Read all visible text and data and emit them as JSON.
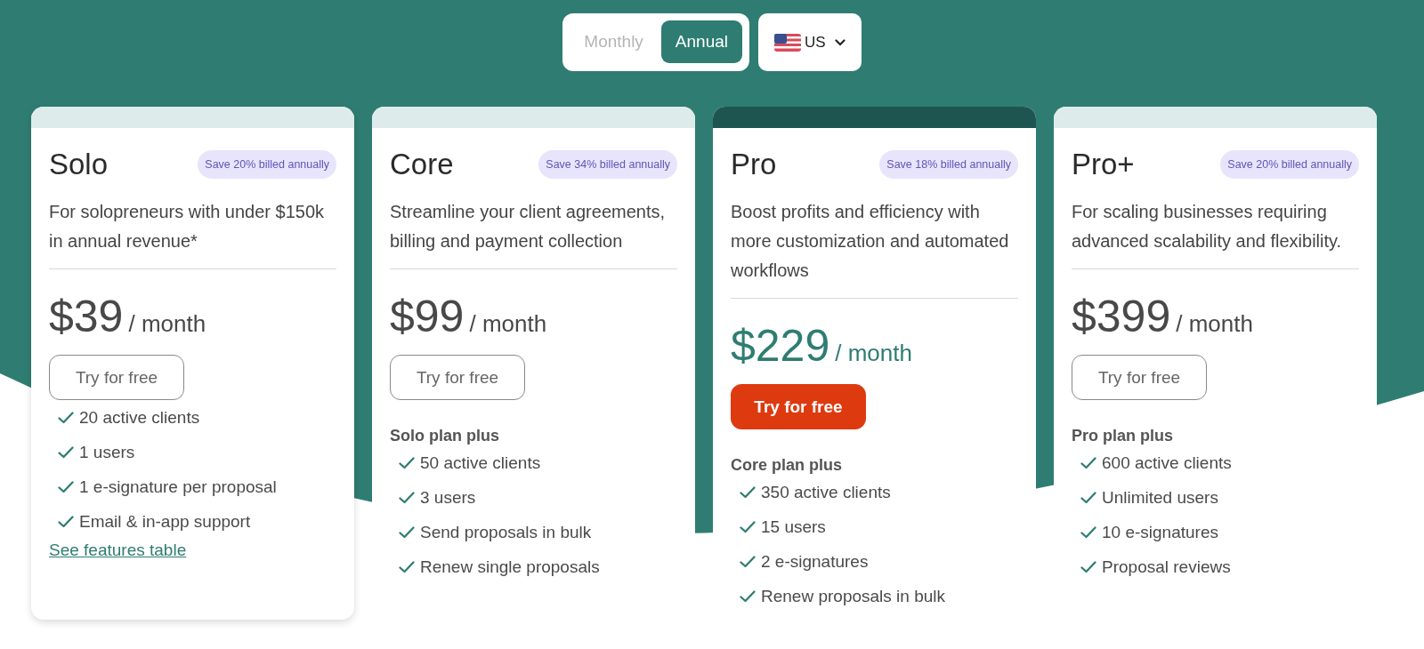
{
  "billing_toggle": [
    {
      "label": "Monthly",
      "selected": false
    },
    {
      "label": "Annual",
      "selected": true
    }
  ],
  "region_selector": {
    "label": "US"
  },
  "plans": [
    {
      "name": "Solo",
      "badge": "Save 20% billed annually",
      "description": "For solopreneurs with under $150k in annual revenue*",
      "price": "$39",
      "period": "/ month",
      "button": "Try for free",
      "featured": false,
      "features": [
        "20 active clients",
        "1 users",
        "1 e-signature per proposal",
        "Email & in-app support"
      ],
      "link": "See features table"
    },
    {
      "name": "Core",
      "badge": "Save 34% billed annually",
      "description": "Streamline your client agreements, billing and payment collection",
      "price": "$99",
      "period": "/ month",
      "button": "Try for free",
      "featured": false,
      "subheading": "Solo plan plus",
      "features": [
        "50 active clients",
        "3 users",
        "Send proposals in bulk",
        "Renew single proposals"
      ]
    },
    {
      "name": "Pro",
      "badge": "Save 18% billed annually",
      "description": "Boost profits and efficiency with more customization and automated workflows",
      "price": "$229",
      "period": "/ month",
      "button": "Try for free",
      "featured": true,
      "subheading": "Core plan plus",
      "features": [
        "350 active clients",
        "15 users",
        "2 e-signatures",
        "Renew proposals in bulk"
      ]
    },
    {
      "name": "Pro+",
      "badge": "Save 20% billed annually",
      "description": "For scaling businesses requiring advanced scalability and flexibility.",
      "price": "$399",
      "period": "/ month",
      "button": "Try for free",
      "featured": false,
      "subheading": "Pro plan plus",
      "features": [
        "600 active clients",
        "Unlimited users",
        "10 e-signatures",
        "Proposal reviews"
      ]
    }
  ]
}
